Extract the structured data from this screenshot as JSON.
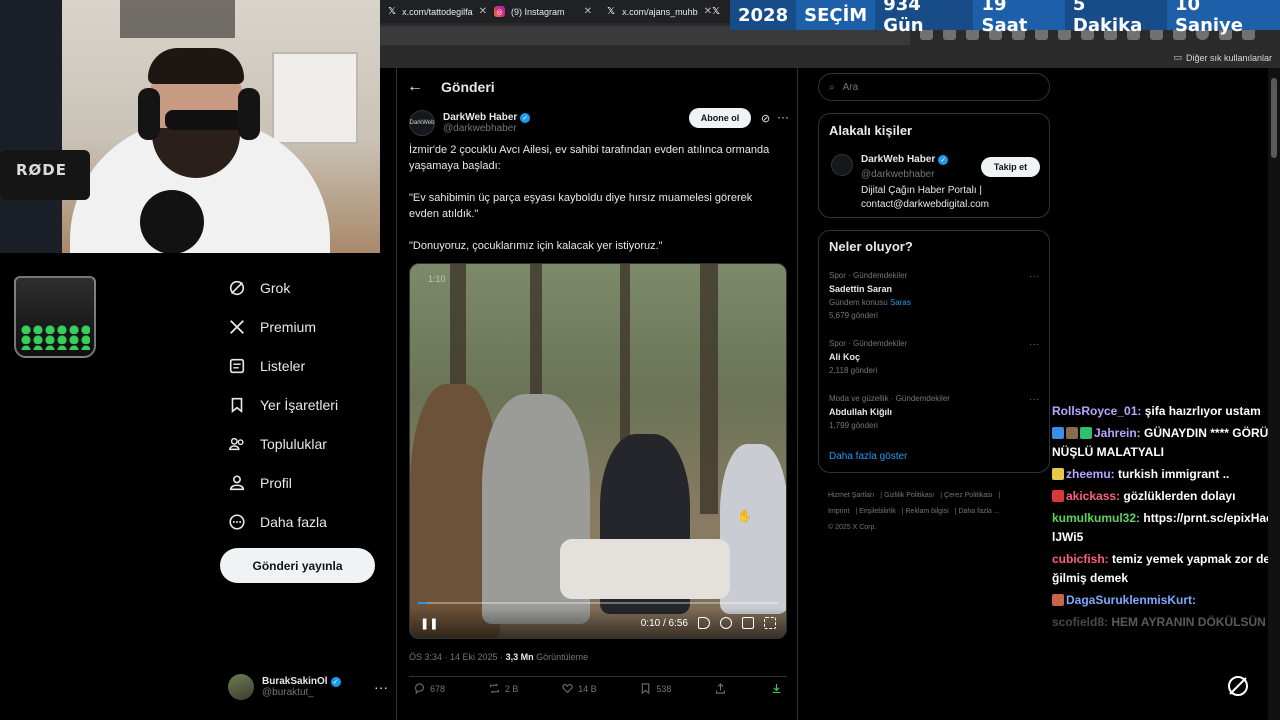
{
  "browser": {
    "tabs": [
      {
        "label": "x.com/tattodegilfa",
        "icon": "x-icon"
      },
      {
        "label": "(9) Instagram",
        "icon": "instagram-icon"
      },
      {
        "label": "x.com/ajans_muhb",
        "icon": "x-icon"
      }
    ],
    "bookmarks_label": "Diğer sık kullanılanlar"
  },
  "countdown": {
    "year": "2028",
    "label": "SEÇİM",
    "days": "934 Gün",
    "hours": "19 Saat",
    "minutes": "5 Dakika",
    "seconds": "10 Saniye"
  },
  "webcam": {
    "mic_brand": "RØDE"
  },
  "nav": {
    "items": [
      {
        "label": "Grok",
        "icon": "grok-icon"
      },
      {
        "label": "Premium",
        "icon": "x-premium-icon"
      },
      {
        "label": "Listeler",
        "icon": "lists-icon"
      },
      {
        "label": "Yer İşaretleri",
        "icon": "bookmark-icon"
      },
      {
        "label": "Topluluklar",
        "icon": "communities-icon"
      },
      {
        "label": "Profil",
        "icon": "profile-icon"
      },
      {
        "label": "Daha fazla",
        "icon": "more-circle-icon"
      }
    ],
    "post_button": "Gönderi yayınla",
    "account": {
      "name": "BurakSakinOl",
      "handle": "@buraktut_"
    }
  },
  "post": {
    "page_title": "Gönderi",
    "author": {
      "name": "DarkWeb Haber",
      "handle": "@darkwebhaber",
      "avatar_text": "DarkWeb"
    },
    "subscribe_label": "Abone ol",
    "text": [
      "İzmir'de 2 çocuklu Avcı Ailesi, ev sahibi tarafından evden atılınca ormanda yaşamaya başladı:",
      "\"Ev sahibimin üç parça eşyası kayboldu diye hırsız muamelesi görerek evden atıldık.\"",
      "\"Donuyoruz, çocuklarımız için kalacak yer istiyoruz.\""
    ],
    "video": {
      "badge": "1:10",
      "time": "0:10 / 6:56",
      "progress": 0.024
    },
    "timestamp": "ÖS 3:34 · 14 Eki 2025 ·",
    "views_count": "3,3 Mn",
    "views_label": "Görüntüleme",
    "actions": {
      "replies": "678",
      "reposts": "2 B",
      "likes": "14 B",
      "bookmarks": "538"
    }
  },
  "sidebar": {
    "search_placeholder": "Ara",
    "relevant": {
      "title": "Alakalı kişiler",
      "name": "DarkWeb Haber",
      "handle": "@darkwebhaber",
      "bio": "Dijital Çağın Haber Portalı | contact@darkwebdigital.com",
      "follow_label": "Takip et"
    },
    "trends": {
      "title": "Neler oluyor?",
      "items": [
        {
          "category": "Spor · Gündemdekiler",
          "name": "Sadettin Saran",
          "extra_prefix": "Gündem konusu",
          "extra_link": "Saras",
          "count": "5,679 gönderi"
        },
        {
          "category": "Spor · Gündemdekiler",
          "name": "Ali Koç",
          "count": "2,118 gönderi"
        },
        {
          "category": "Moda ve güzellik · Gündemdekiler",
          "name": "Abdullah Kiğılı",
          "count": "1,799 gönderi"
        }
      ],
      "show_more": "Daha fazla göster"
    },
    "footer": [
      "Hizmet Şartları",
      "Gizlilik Politikası",
      "Çerez Politikası",
      "Imprint",
      "Erişilebilirlik",
      "Reklam bilgisi",
      "Daha fazla ...",
      "© 2025 X Corp."
    ]
  },
  "chat": {
    "messages": [
      {
        "user": "RollsRoyce_01",
        "color": "#b8a6ff",
        "text": "şifa haızrlıyor ustam"
      },
      {
        "user": "Jahrein",
        "color": "#b8a6ff",
        "text": "GÜNAYDIN **** GÖRÜNÜŞLÜ MALATYALI",
        "badges": [
          "#3a8ee6",
          "#8a6b4a",
          "#2fbf71"
        ]
      },
      {
        "user": "zheemu",
        "color": "#b8a6ff",
        "text": "turkish immigrant ..",
        "badges": [
          "#e6c84a"
        ]
      },
      {
        "user": "akickass",
        "color": "#ff5f7e",
        "text": "gözlüklerden dolayı",
        "badges": [
          "#d83a3a"
        ]
      },
      {
        "user": "kumulkumul32",
        "color": "#5fd35f",
        "text": "https://prnt.sc/epixHaelJWi5"
      },
      {
        "user": "cubicfish",
        "color": "#ff5f7e",
        "text": "temiz yemek yapmak zor değilmiş demek"
      },
      {
        "user": "DagaSuruklenmisKurt",
        "color": "#7fa8ff",
        "text": "",
        "badges": [
          "#c8644a"
        ]
      },
      {
        "user": "scofield8",
        "color": "#cfcfcf",
        "text": "HEM AYRANIN DÖKÜLSÜN"
      }
    ]
  }
}
